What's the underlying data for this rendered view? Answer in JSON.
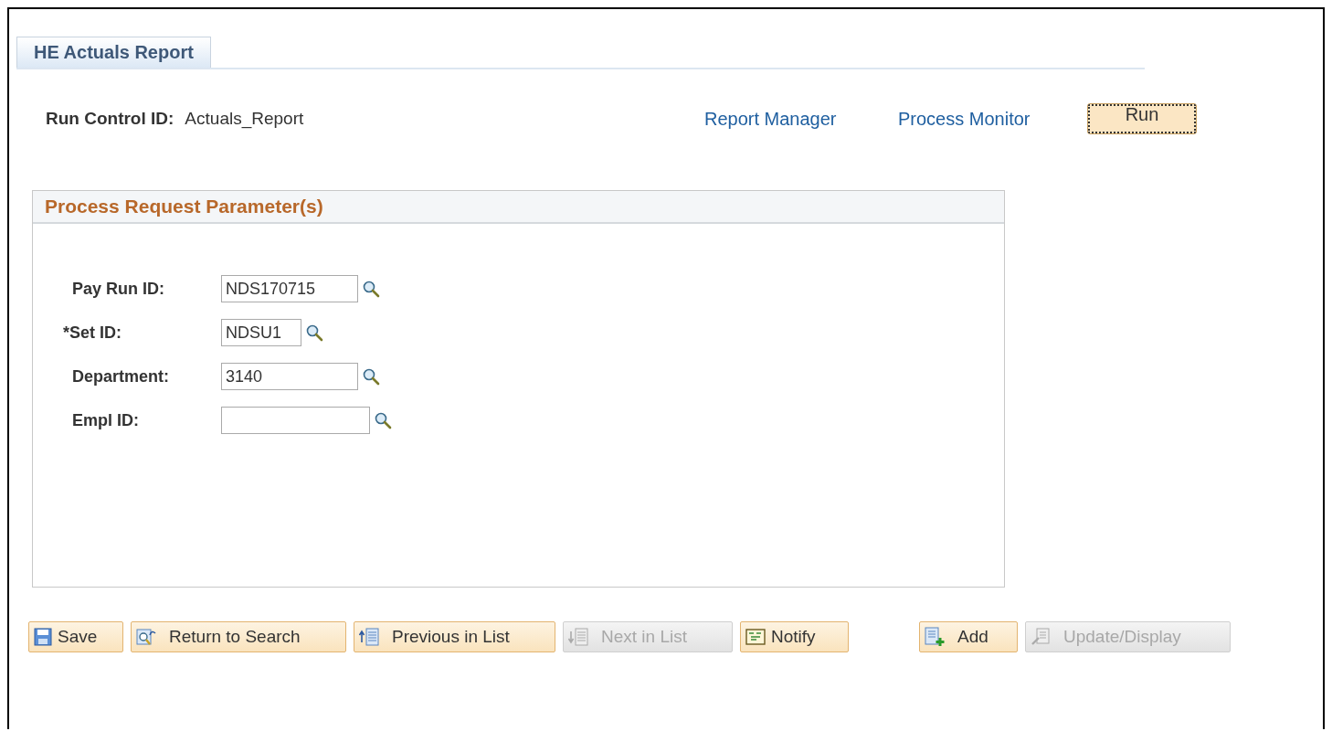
{
  "tabs": [
    {
      "label": "HE Actuals Report",
      "selected": true
    }
  ],
  "run_control": {
    "label": "Run Control ID:",
    "value": "Actuals_Report"
  },
  "links": [
    "Report Manager",
    "Process Monitor"
  ],
  "run_button": {
    "label": "Run",
    "focused": true
  },
  "panel": {
    "title": "Process Request Parameter(s)",
    "fields": [
      {
        "label": "Pay Run ID:",
        "value": "NDS170715"
      },
      {
        "label": "*Set ID:",
        "value": "NDSU1"
      },
      {
        "label": "Department:",
        "value": "3140"
      },
      {
        "label": "Empl ID:"
      }
    ]
  },
  "buttons": [
    {
      "label": "Save",
      "kind": "save",
      "disabled": false
    },
    {
      "label": "Return to Search",
      "kind": "search",
      "disabled": false
    },
    {
      "label": "Previous in List",
      "kind": "previous",
      "disabled": false
    },
    {
      "label": "Next in List",
      "kind": "next",
      "disabled": true
    },
    {
      "label": "Notify",
      "kind": "notify",
      "disabled": false
    },
    {
      "label": "Add",
      "kind": "add",
      "disabled": false
    },
    {
      "label": "Update/Display",
      "kind": "update",
      "disabled": true
    }
  ]
}
